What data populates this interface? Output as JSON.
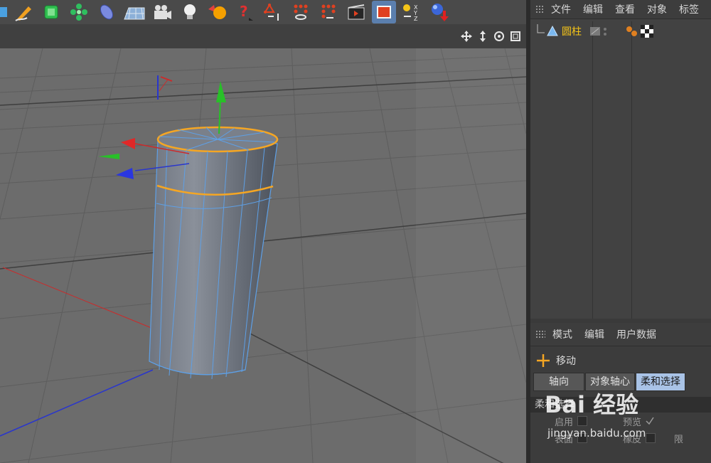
{
  "toolbar": {
    "tools": [
      {
        "name": "cube",
        "label": ""
      },
      {
        "name": "pen",
        "label": ""
      },
      {
        "name": "subdivision",
        "label": ""
      },
      {
        "name": "cloner",
        "label": ""
      },
      {
        "name": "deformer",
        "label": ""
      },
      {
        "name": "floor",
        "label": ""
      },
      {
        "name": "camera",
        "label": ""
      },
      {
        "name": "light",
        "label": ""
      },
      {
        "name": "material",
        "label": ""
      },
      {
        "name": "tag",
        "label": "?"
      },
      {
        "name": "point-mode",
        "label": ""
      },
      {
        "name": "edge-mode",
        "label": ""
      },
      {
        "name": "polygon-mode",
        "label": ""
      },
      {
        "name": "render-view",
        "label": ""
      },
      {
        "name": "render-active",
        "label": ""
      },
      {
        "name": "axis-xyz",
        "label": "XYZ"
      },
      {
        "name": "gravity",
        "label": ""
      }
    ]
  },
  "viewport": {
    "nav_icons": [
      "move-view-icon",
      "dolly-view-icon",
      "rotate-view-icon",
      "maximize-view-icon"
    ],
    "accent": "#f5a623",
    "wire_color": "#5ea0e6",
    "axis_x_color": "#e03030",
    "axis_y_color": "#28c028",
    "axis_z_color": "#2a3cf0"
  },
  "object_manager": {
    "menu": [
      "文件",
      "编辑",
      "查看",
      "对象",
      "标签"
    ],
    "object": {
      "name": "圆柱",
      "name_color": "#f5c518"
    }
  },
  "attribute_manager": {
    "menu": [
      "模式",
      "编辑",
      "用户数据"
    ],
    "tool_name": "移动",
    "tabs": [
      "轴向",
      "对象轴心",
      "柔和选择"
    ],
    "active_tab": "柔和选择",
    "section_title": "柔和选择",
    "options": [
      {
        "label": "启用",
        "second": "预览"
      },
      {
        "label": "表面",
        "second": "橡皮",
        "third": "限"
      }
    ]
  },
  "watermark": {
    "logo": "Bai 经验",
    "site": "jingyan.baidu.com"
  }
}
